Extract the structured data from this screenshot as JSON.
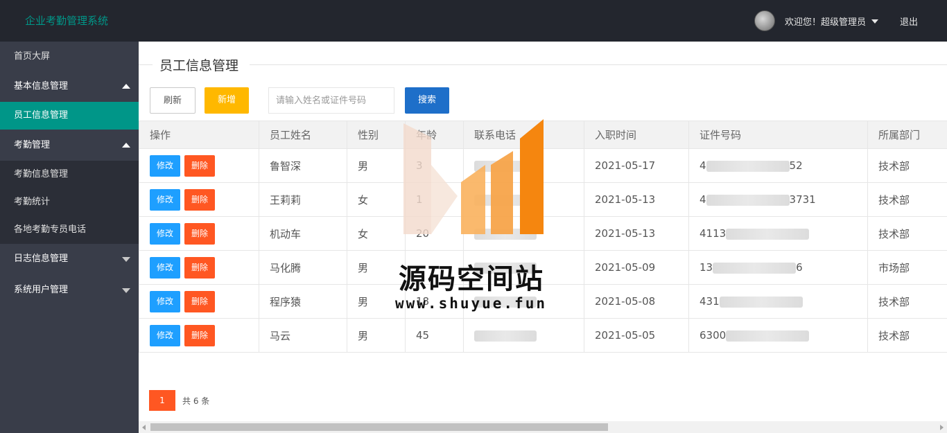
{
  "app": {
    "title": "企业考勤管理系统"
  },
  "header": {
    "welcome": "欢迎您！超级管理员",
    "logout": "退出"
  },
  "sidebar": {
    "items": [
      {
        "label": "首页大屏"
      },
      {
        "label": "基本信息管理",
        "expanded": true,
        "children": [
          {
            "label": "员工信息管理",
            "active": true
          }
        ]
      },
      {
        "label": "考勤管理",
        "expanded": true,
        "children": [
          {
            "label": "考勤信息管理"
          },
          {
            "label": "考勤统计"
          },
          {
            "label": "各地考勤专员电话"
          }
        ]
      },
      {
        "label": "日志信息管理",
        "expanded": false
      },
      {
        "label": "系统用户管理",
        "expanded": false
      }
    ]
  },
  "page": {
    "title": "员工信息管理"
  },
  "toolbar": {
    "refresh_label": "刷新",
    "add_label": "新增",
    "search_placeholder": "请输入姓名或证件号码",
    "search_label": "搜索"
  },
  "table": {
    "columns": [
      "操作",
      "员工姓名",
      "性别",
      "年龄",
      "联系电话",
      "入职时间",
      "证件号码",
      "所属部门"
    ],
    "edit_label": "修改",
    "delete_label": "删除",
    "rows": [
      {
        "name": "鲁智深",
        "gender": "男",
        "age": "3",
        "phone": "",
        "hire_date": "2021-05-17",
        "id_prefix": "4",
        "id_suffix": "52",
        "dept": "技术部"
      },
      {
        "name": "王莉莉",
        "gender": "女",
        "age": "1",
        "phone": "",
        "hire_date": "2021-05-13",
        "id_prefix": "4",
        "id_suffix": "3731",
        "dept": "技术部"
      },
      {
        "name": "机动车",
        "gender": "女",
        "age": "20",
        "phone": "",
        "hire_date": "2021-05-13",
        "id_prefix": "4113",
        "id_suffix": "",
        "dept": "技术部"
      },
      {
        "name": "马化腾",
        "gender": "男",
        "age": "",
        "phone": "",
        "hire_date": "2021-05-09",
        "id_prefix": "13",
        "id_suffix": "6",
        "dept": "市场部"
      },
      {
        "name": "程序猿",
        "gender": "男",
        "age": "18",
        "phone": "",
        "hire_date": "2021-05-08",
        "id_prefix": "431",
        "id_suffix": "",
        "dept": "技术部"
      },
      {
        "name": "马云",
        "gender": "男",
        "age": "45",
        "phone": "",
        "hire_date": "2021-05-05",
        "id_prefix": "6300",
        "id_suffix": "",
        "dept": "技术部"
      }
    ]
  },
  "pagination": {
    "current_page": "1",
    "total_text": "共 6 条"
  },
  "watermark": {
    "text": "源码空间站",
    "url": "www.shuyue.fun"
  },
  "colors": {
    "topbar": "#23262e",
    "sidebar": "#393d49",
    "accent": "#009688",
    "add_button": "#ffb800",
    "search_button": "#1e6fc9",
    "edit_button": "#1e9fff",
    "delete_button": "#ff5722"
  }
}
